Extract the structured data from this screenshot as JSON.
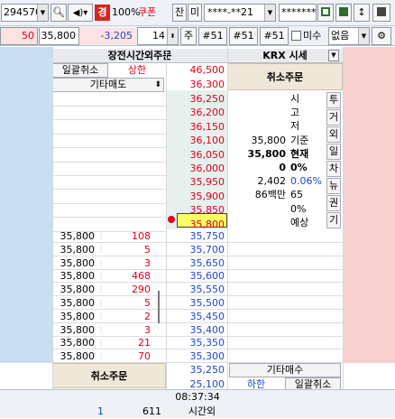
{
  "toolbar": {
    "stock_code": "294570",
    "badge_gyeong": "경",
    "percent": "100%",
    "coupon": "쿠폰",
    "jan_label": "잔",
    "mi_label": "미",
    "account_masked": "****-**21",
    "password_masked": "*******"
  },
  "order_bar": {
    "qty": "50",
    "price": "35,800",
    "change": "-3,205",
    "step": "14",
    "unit_label": "주",
    "qty_btn1": "#51",
    "qty_btn2": "#51",
    "qty_btn3": "#51",
    "unfilled_label": "미수",
    "none_option": "없음"
  },
  "headers": {
    "after_hours": "장전시간외주문",
    "krx": "KRX 시세"
  },
  "sell_side": {
    "cancel_all": "일괄취소",
    "upper_limit": "상한",
    "upper_price": "46,500",
    "other_sell": "기타매도",
    "other_sell_price": "36,300",
    "cancel_order": "취소주문"
  },
  "ask_prices": [
    "36,250",
    "36,200",
    "36,150",
    "36,100",
    "36,050",
    "36,000",
    "35,950",
    "35,900",
    "35,850",
    "35,800"
  ],
  "info_labels": [
    "시",
    "고",
    "저",
    "기준",
    "현재",
    "0%",
    "0.06%",
    "65",
    "0%",
    "예상"
  ],
  "info_values": [
    "",
    "",
    "",
    "35,800",
    "35,800",
    "0",
    "2,402",
    "86백만",
    "",
    ""
  ],
  "side_tabs": [
    "투",
    "거",
    "외",
    "일",
    "차",
    "뉴",
    "권",
    "기"
  ],
  "bid_rows": [
    {
      "price_left": "35,800",
      "qty": "108",
      "bid": "35,750"
    },
    {
      "price_left": "35,800",
      "qty": "5",
      "bid": "35,700"
    },
    {
      "price_left": "35,800",
      "qty": "3",
      "bid": "35,650"
    },
    {
      "price_left": "35,800",
      "qty": "468",
      "bid": "35,600"
    },
    {
      "price_left": "35,800",
      "qty": "290",
      "bid": "35,550"
    },
    {
      "price_left": "35,800",
      "qty": "5",
      "bid": "35,500"
    },
    {
      "price_left": "35,800",
      "qty": "2",
      "bid": "35,450"
    },
    {
      "price_left": "35,800",
      "qty": "3",
      "bid": "35,400"
    },
    {
      "price_left": "35,800",
      "qty": "21",
      "bid": "35,350"
    },
    {
      "price_left": "35,800",
      "qty": "70",
      "bid": "35,300"
    }
  ],
  "buy_side": {
    "cancel_order": "취소주문",
    "other_buy_price": "35,250",
    "other_buy": "기타매수",
    "lower_price": "25,100",
    "lower_limit": "하한",
    "cancel_all": "일괄취소"
  },
  "footer": {
    "time": "08:37:34",
    "count": "1",
    "volume": "611",
    "after_hours_label": "시간외"
  },
  "colors": {
    "ask_bg": "#c9dff1",
    "bid_bg": "#f6cfcf",
    "center_bg": "#e9f3ef",
    "accent_red": "#e0001b",
    "accent_blue": "#1f47d1",
    "current_price_bg": "#ffff66"
  }
}
